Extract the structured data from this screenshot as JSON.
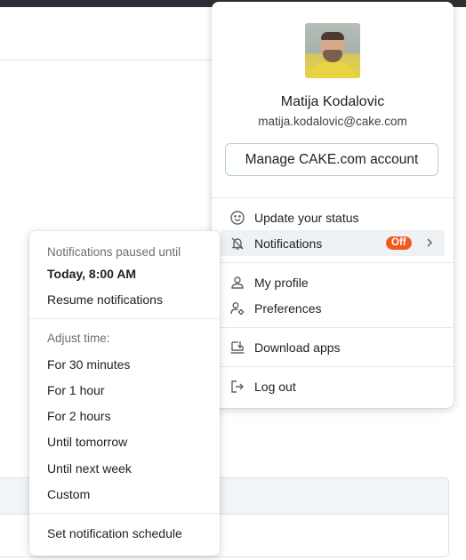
{
  "account": {
    "name": "Matija Kodalovic",
    "email": "matija.kodalovic@cake.com",
    "manage_label": "Manage CAKE.com account"
  },
  "menu": {
    "status_label": "Update your status",
    "notifications_label": "Notifications",
    "notifications_badge": "Off",
    "profile_label": "My profile",
    "preferences_label": "Preferences",
    "download_label": "Download apps",
    "logout_label": "Log out"
  },
  "notifications": {
    "paused_label": "Notifications paused until",
    "paused_until": "Today, 8:00 AM",
    "resume_label": "Resume notifications",
    "adjust_label": "Adjust time:",
    "options": [
      "For 30 minutes",
      "For 1 hour",
      "For 2 hours",
      "Until tomorrow",
      "Until next week",
      "Custom"
    ],
    "schedule_label": "Set notification schedule"
  },
  "colors": {
    "badge": "#f05a22",
    "button_border": "#b9cfd7",
    "active_row": "#eef2f4"
  }
}
